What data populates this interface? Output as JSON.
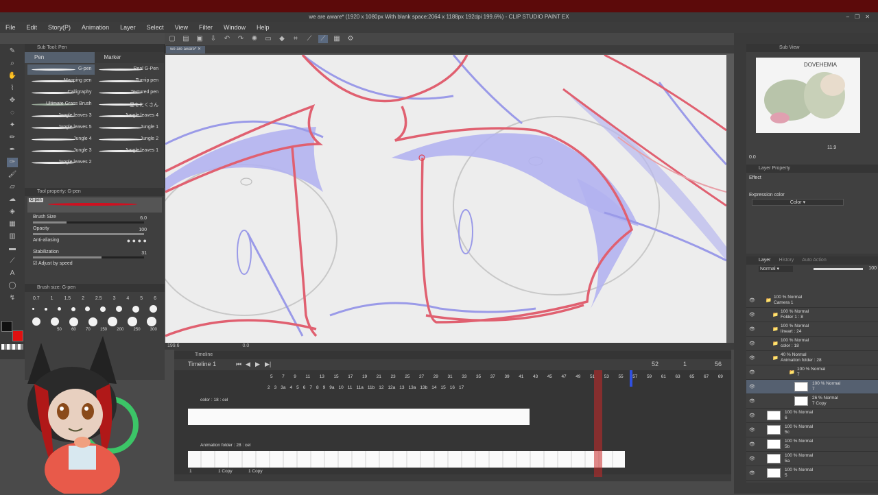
{
  "window": {
    "title": "we are aware* (1920 x 1080px With blank space:2064 x 1188px 192dpi 199.6%) - CLIP STUDIO PAINT EX",
    "controls": [
      "–",
      "❐",
      "✕"
    ]
  },
  "menu": [
    "File",
    "Edit",
    "Story(P)",
    "Animation",
    "Layer",
    "Select",
    "View",
    "Filter",
    "Window",
    "Help"
  ],
  "subtool": {
    "header": "Sub Tool: Pen",
    "tabs": [
      "Pen",
      "Marker"
    ],
    "brushes_left": [
      "G-pen",
      "Mapping pen",
      "Calligraphy",
      "Ultimate Grass Brush",
      "Jungle leaves 3",
      "Jungle leaves 5",
      "Jungle 4",
      "Jungle 3",
      "Jungle leaves 2"
    ],
    "brushes_right": [
      "Real G-Pen",
      "Turnip pen",
      "Textured pen",
      "星をたくさん",
      "Jungle leaves 4",
      "Jungle 1",
      "Jungle 2",
      "Jungle leaves 1"
    ]
  },
  "toolprop": {
    "header": "Tool property: G-pen",
    "preview_label": "G-pen",
    "brush_size_label": "Brush Size",
    "brush_size": "6.0",
    "opacity_label": "Opacity",
    "opacity": "100",
    "antialias_label": "Anti-aliasing",
    "stabilization_label": "Stabilization",
    "stabilization": "31",
    "adjust_label": "Adjust by speed"
  },
  "brushsize": {
    "header": "Brush size: G-pen",
    "sizes": [
      "0.7",
      "1",
      "1.5",
      "2",
      "2.5",
      "3",
      "4",
      "5",
      "6"
    ],
    "sizes_row2": [
      "50",
      "60",
      "70",
      "150",
      "200",
      "250",
      "300"
    ]
  },
  "document": {
    "tab": "we are aware*",
    "zoom": "199.6",
    "angle": "0.0"
  },
  "timeline": {
    "header": "Timeline",
    "name": "Timeline 1",
    "frame_current": "52",
    "frame_start": "1",
    "frame_end": "56",
    "ruler": [
      "5",
      "7",
      "9",
      "11",
      "13",
      "15",
      "17",
      "19",
      "21",
      "23",
      "25",
      "27",
      "29",
      "31",
      "33",
      "35",
      "37",
      "39",
      "41",
      "43",
      "45",
      "47",
      "49",
      "51",
      "53",
      "55",
      "57",
      "59",
      "61",
      "63",
      "65",
      "67",
      "69"
    ],
    "tracks": [
      {
        "label": "color : 18 : cel",
        "nums": [
          "2",
          "3",
          "3a",
          "4",
          "5",
          "6",
          "7",
          "8",
          "9",
          "9a",
          "10",
          "11",
          "11a",
          "11b",
          "12",
          "12a",
          "13",
          "13a",
          "13b",
          "14",
          "15",
          "16",
          "17"
        ]
      },
      {
        "label": "Animation folder : 28 : cel",
        "nums": [
          "1",
          "1 Copy",
          "1 Copy"
        ]
      }
    ]
  },
  "subview": {
    "header": "Sub View",
    "thumb_text": "DOVEHEMIA",
    "zoom": "11.9",
    "angle": "0.0"
  },
  "layerprop": {
    "header": "Layer Property",
    "effect_label": "Effect",
    "expression_label": "Expression color",
    "expression_value": "Color"
  },
  "layers": {
    "tabs": [
      "Layer",
      "History",
      "Auto Action"
    ],
    "blend": "Normal",
    "opacity": "100",
    "rows": [
      {
        "l1": "100 % Normal",
        "l2": "Camera 1",
        "indent": 40,
        "folder": true
      },
      {
        "l1": "100 % Normal",
        "l2": "Folder 1 : 8",
        "indent": 50,
        "folder": true
      },
      {
        "l1": "100 % Normal",
        "l2": "lineart : 24",
        "indent": 50,
        "folder": true
      },
      {
        "l1": "100 % Normal",
        "l2": "color : 18",
        "indent": 50,
        "folder": true
      },
      {
        "l1": "40 % Normal",
        "l2": "Animation folder : 28",
        "indent": 50,
        "folder": true
      },
      {
        "l1": "100 % Normal",
        "l2": "7",
        "indent": 74,
        "folder": true
      },
      {
        "l1": "100 % Normal",
        "l2": "7",
        "indent": 96,
        "folder": false,
        "active": true
      },
      {
        "l1": "26 % Normal",
        "l2": "7 Copy",
        "indent": 96,
        "folder": false
      },
      {
        "l1": "100 % Normal",
        "l2": "6",
        "indent": 56,
        "folder": false
      },
      {
        "l1": "100 % Normal",
        "l2": "5c",
        "indent": 56,
        "folder": false
      },
      {
        "l1": "100 % Normal",
        "l2": "5b",
        "indent": 56,
        "folder": false
      },
      {
        "l1": "100 % Normal",
        "l2": "5a",
        "indent": 56,
        "folder": false
      },
      {
        "l1": "100 % Normal",
        "l2": "5",
        "indent": 56,
        "folder": false
      }
    ]
  },
  "colors": {
    "main": "#111111",
    "sub": "#e01010",
    "accent": "#556070",
    "stroke_red": "#e06070",
    "stroke_blue": "#8a8ae8"
  }
}
